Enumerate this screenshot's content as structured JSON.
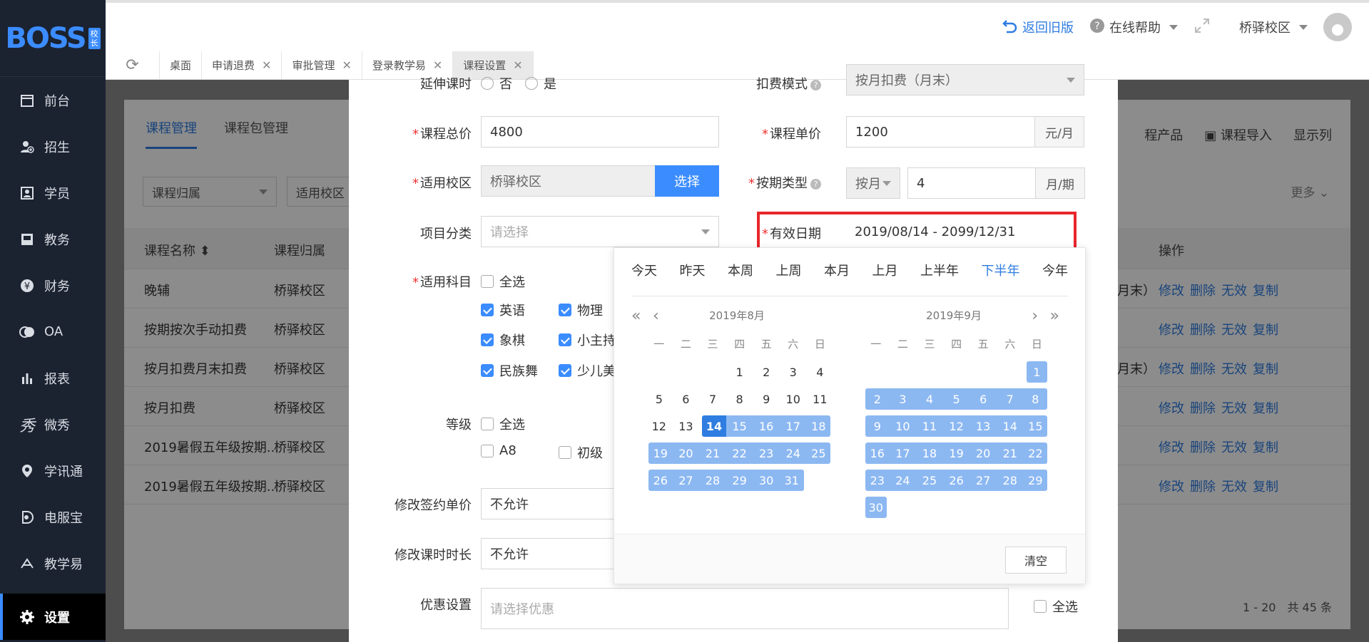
{
  "sidebar": {
    "logo": "BOSS",
    "logo_badge": [
      "校",
      "长"
    ],
    "items": [
      {
        "label": "前台",
        "icon": "calendar-icon"
      },
      {
        "label": "招生",
        "icon": "add-user-icon"
      },
      {
        "label": "学员",
        "icon": "student-card-icon"
      },
      {
        "label": "教务",
        "icon": "book-icon"
      },
      {
        "label": "财务",
        "icon": "yen-icon"
      },
      {
        "label": "OA",
        "icon": "oa-icon"
      },
      {
        "label": "报表",
        "icon": "bar-chart-icon"
      },
      {
        "label": "微秀",
        "icon": "xiu-icon"
      },
      {
        "label": "学讯通",
        "icon": "location-pin-icon"
      },
      {
        "label": "电服宝",
        "icon": "phone-service-icon"
      },
      {
        "label": "教学易",
        "icon": "teach-icon"
      },
      {
        "label": "设置",
        "icon": "gear-icon"
      }
    ]
  },
  "topbar": {
    "back_label": "返回旧版",
    "help_label": "在线帮助",
    "campus_label": "桥驿校区"
  },
  "tabs": [
    {
      "label": "桌面",
      "closable": false
    },
    {
      "label": "申请退费",
      "closable": true
    },
    {
      "label": "审批管理",
      "closable": true
    },
    {
      "label": "登录教学易",
      "closable": true
    },
    {
      "label": "课程设置",
      "closable": true
    }
  ],
  "background": {
    "subtabs": [
      "课程管理",
      "课程包管理"
    ],
    "tools": [
      "程产品",
      "课程导入",
      "显示列"
    ],
    "filters": [
      "课程归属",
      "适用校区"
    ],
    "more": "更多",
    "columns": [
      "课程名称",
      "课程归属",
      "操作"
    ],
    "rows": [
      {
        "name": "晚辅",
        "owner": "桥驿校区",
        "extra": "月末）"
      },
      {
        "name": "按期按次手动扣费",
        "owner": "桥驿校区",
        "extra": ""
      },
      {
        "name": "按月扣费月末扣费",
        "owner": "桥驿校区",
        "extra": "月末）"
      },
      {
        "name": "按月扣费",
        "owner": "桥驿校区",
        "extra": ""
      },
      {
        "name": "2019暑假五年级按期...",
        "owner": "桥驿校区",
        "extra": ""
      },
      {
        "name": "2019暑假五年级按期...",
        "owner": "桥驿校区",
        "extra": ""
      }
    ],
    "ops": [
      "修改",
      "删除",
      "无效",
      "复制"
    ],
    "pager": "1 - 20　共 45 条"
  },
  "form": {
    "extend_label": "延伸课时",
    "extend_options": [
      "否",
      "是"
    ],
    "deduct_label": "扣费模式",
    "deduct_value": "按月扣费（月末）",
    "total_price_label": "课程总价",
    "total_price": "4800",
    "unit_price_label": "课程单价",
    "unit_price": "1200",
    "unit_price_suffix": "元/月",
    "campus_label": "适用校区",
    "campus_value": "桥驿校区",
    "campus_button": "选择",
    "period_label": "按期类型",
    "period_type": "按月",
    "period_value": "4",
    "period_suffix": "月/期",
    "category_label": "项目分类",
    "category_placeholder": "请选择",
    "valid_date_label": "有效日期",
    "valid_date_value": "2019/08/14 - 2099/12/31",
    "subjects_label": "适用科目",
    "select_all": "全选",
    "subjects": [
      {
        "label": "英语",
        "checked": true
      },
      {
        "label": "物理",
        "checked": true
      },
      {
        "label": "象棋",
        "checked": true
      },
      {
        "label": "小主持",
        "checked": true
      },
      {
        "label": "民族舞",
        "checked": true
      },
      {
        "label": "少儿美",
        "checked": true
      }
    ],
    "level_label": "等级",
    "levels": [
      {
        "label": "A8",
        "checked": false
      },
      {
        "label": "初级",
        "checked": false
      }
    ],
    "modify_price_label": "修改签约单价",
    "modify_price_value": "不允许",
    "modify_hours_label": "修改课时时长",
    "modify_hours_value": "不允许",
    "discount_label": "优惠设置",
    "discount_placeholder": "请选择优惠"
  },
  "datepicker": {
    "shortcuts": [
      "今天",
      "昨天",
      "本周",
      "上周",
      "本月",
      "上月",
      "上半年",
      "下半年",
      "今年"
    ],
    "active_shortcut": "下半年",
    "weekdays": [
      "一",
      "二",
      "三",
      "四",
      "五",
      "六",
      "日"
    ],
    "left_title": "2019年8月",
    "right_title": "2019年9月",
    "clear_label": "清空"
  },
  "colors": {
    "primary": "#3b8cff",
    "range": "#8cb8f2",
    "highlight": "#e8262a",
    "sidebar": "#1b2230"
  }
}
